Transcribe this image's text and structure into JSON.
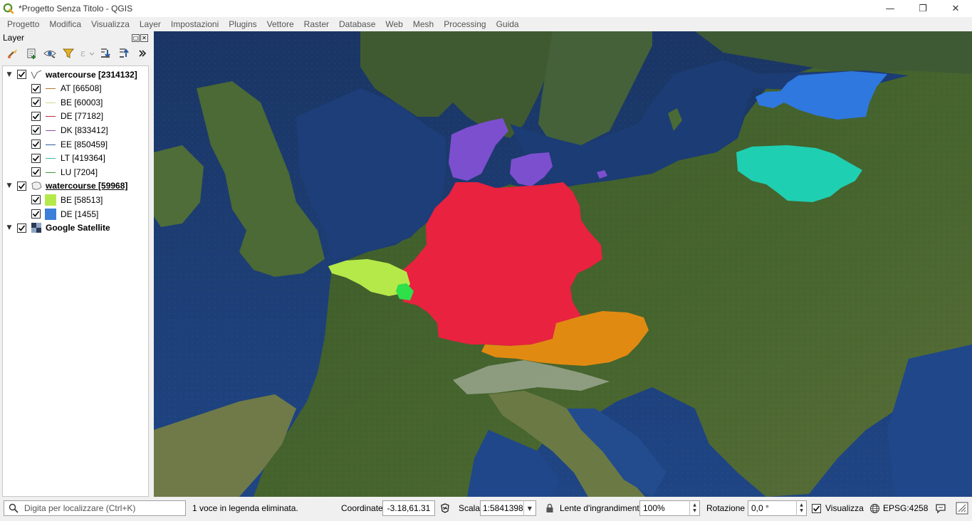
{
  "window": {
    "title": "*Progetto Senza Titolo - QGIS",
    "minimize": "—",
    "maximize": "❐",
    "close": "✕"
  },
  "menu": [
    "Progetto",
    "Modifica",
    "Visualizza",
    "Layer",
    "Impostazioni",
    "Plugins",
    "Vettore",
    "Raster",
    "Database",
    "Web",
    "Mesh",
    "Processing",
    "Guida"
  ],
  "layers_panel": {
    "title": "Layer",
    "toolbar_icons": [
      "style-icon",
      "add-group-icon",
      "visibility-icon",
      "filter-icon",
      "expression-filter-icon",
      "expand-all-icon",
      "collapse-all-icon",
      "more-icon"
    ],
    "tree": [
      {
        "type": "group",
        "label": "watercourse [2314132]",
        "geometry": "line",
        "checked": true
      },
      {
        "type": "class",
        "label": "AT [66508]",
        "color": "#b07a2e",
        "symbol": "line",
        "checked": true
      },
      {
        "type": "class",
        "label": "BE [60003]",
        "color": "#c7dd8a",
        "symbol": "line",
        "checked": true
      },
      {
        "type": "class",
        "label": "DE [77182]",
        "color": "#c22b45",
        "symbol": "line",
        "checked": true
      },
      {
        "type": "class",
        "label": "DK [833412]",
        "color": "#8a4fa3",
        "symbol": "line",
        "checked": true
      },
      {
        "type": "class",
        "label": "EE [850459]",
        "color": "#2f5f9e",
        "symbol": "line",
        "checked": true
      },
      {
        "type": "class",
        "label": "LT [419364]",
        "color": "#38b7a8",
        "symbol": "line",
        "checked": true
      },
      {
        "type": "class",
        "label": "LU [7204]",
        "color": "#3a9a3a",
        "symbol": "line",
        "checked": true
      },
      {
        "type": "group",
        "label": "watercourse [59968]",
        "geometry": "polygon",
        "checked": true
      },
      {
        "type": "class",
        "label": "BE [58513]",
        "color": "#b5e94a",
        "symbol": "fill",
        "checked": true
      },
      {
        "type": "class",
        "label": "DE [1455]",
        "color": "#3b7fd9",
        "symbol": "fill",
        "checked": true
      },
      {
        "type": "group",
        "label": "Google Satellite",
        "geometry": "raster",
        "checked": true
      }
    ]
  },
  "map_colors": {
    "AT": "#e18a12",
    "BE": "#b5e94a",
    "LU": "#2ee04a",
    "DE": "#e8223f",
    "DK": "#7c4fcf",
    "EE": "#2f78e0",
    "LT": "#1fcfb2"
  },
  "status": {
    "locator_placeholder": "Digita per localizzare (Ctrl+K)",
    "message": "1 voce in legenda eliminata.",
    "coordinate_label": "Coordinate",
    "coordinate_value": "-3.18,61.31",
    "scale_label": "Scala",
    "scale_value": "1:5841398",
    "magnifier_label": "Lente d'ingrandimento",
    "magnifier_value": "100%",
    "rotation_label": "Rotazione",
    "rotation_value": "0,0 °",
    "render_label": "Visualizza",
    "crs": "EPSG:4258"
  }
}
